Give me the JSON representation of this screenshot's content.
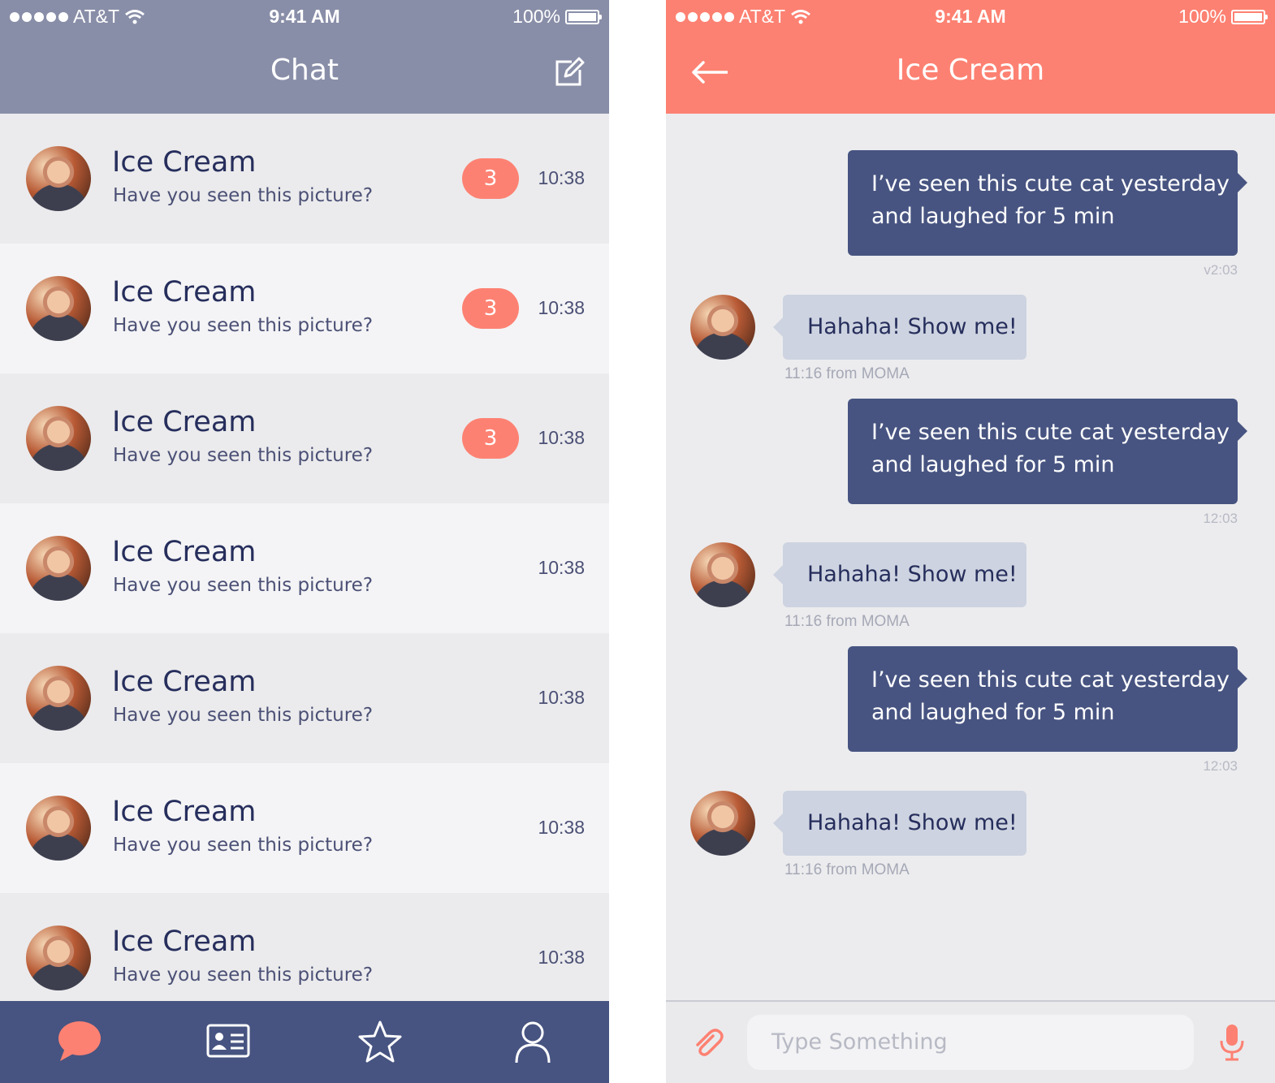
{
  "status_bar": {
    "carrier": "AT&T",
    "time": "9:41 AM",
    "battery": "100%"
  },
  "colors": {
    "list_header": "#898ea8",
    "chat_header": "#fd8172",
    "navy": "#475481",
    "badge": "#fd8172"
  },
  "chat_list": {
    "title": "Chat",
    "compose_icon": "compose-icon",
    "rows": [
      {
        "name": "Ice Cream",
        "message": "Have you seen this picture?",
        "badge": "3",
        "time": "10:38"
      },
      {
        "name": "Ice Cream",
        "message": "Have you seen this picture?",
        "badge": "3",
        "time": "10:38"
      },
      {
        "name": "Ice Cream",
        "message": "Have you seen this picture?",
        "badge": "3",
        "time": "10:38"
      },
      {
        "name": "Ice Cream",
        "message": "Have you seen this picture?",
        "badge": "",
        "time": "10:38"
      },
      {
        "name": "Ice Cream",
        "message": "Have you seen this picture?",
        "badge": "",
        "time": "10:38"
      },
      {
        "name": "Ice Cream",
        "message": "Have you seen this picture?",
        "badge": "",
        "time": "10:38"
      },
      {
        "name": "Ice Cream",
        "message": "Have you seen this picture?",
        "badge": "",
        "time": "10:38"
      }
    ],
    "tabs": [
      "chat-bubble-icon",
      "contact-card-icon",
      "star-icon",
      "profile-icon"
    ]
  },
  "conversation": {
    "title": "Ice Cream",
    "back_icon": "arrow-left-icon",
    "messages": [
      {
        "direction": "out",
        "line1": "I’ve seen this cute cat yesterday",
        "line2": "and laughed for 5 min",
        "stamp": "v2:03"
      },
      {
        "direction": "in",
        "text": "Hahaha! Show me!",
        "stamp": "11:16 from MOMA"
      },
      {
        "direction": "out",
        "line1": "I’ve seen this cute cat yesterday",
        "line2": "and laughed for 5 min",
        "stamp": "12:03"
      },
      {
        "direction": "in",
        "text": "Hahaha! Show me!",
        "stamp": "11:16 from MOMA"
      },
      {
        "direction": "out",
        "line1": "I’ve seen this cute cat yesterday",
        "line2": "and laughed for 5 min",
        "stamp": "12:03"
      },
      {
        "direction": "in",
        "text": "Hahaha! Show me!",
        "stamp": "11:16 from MOMA"
      }
    ],
    "input": {
      "placeholder": "Type Something",
      "attach_icon": "paperclip-icon",
      "mic_icon": "microphone-icon"
    }
  }
}
